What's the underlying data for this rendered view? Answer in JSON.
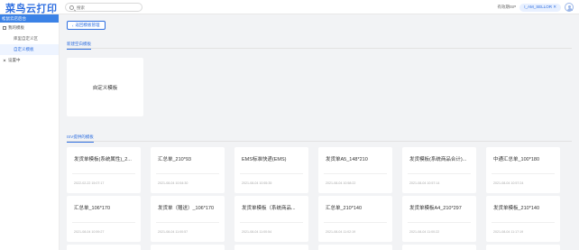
{
  "header": {
    "logo": "菜鸟云打印",
    "search_placeholder": "搜索",
    "link": "有效期ISP",
    "user": "I_AM_SELLOR ✕",
    "accent": "#2f6fe0"
  },
  "sidebar": {
    "title": "松鼠云店后台",
    "group_templates": "我的模板",
    "items": [
      {
        "label": "库里自定义区"
      },
      {
        "label": "自定义模板"
      }
    ],
    "group_settings": "设置中"
  },
  "main": {
    "back_button": "返回模板管理",
    "new_section": "新建空白模板",
    "custom_card": "自定义模板",
    "isv_section": "ISV提供的模板",
    "templates": [
      {
        "name": "发货单模板(系统属性)_2...",
        "date": "2022-02-22 15:07:17"
      },
      {
        "name": "汇总单_210*93",
        "date": "2021-08-04 10:54:30"
      },
      {
        "name": "EMS标准快递(EMS)",
        "date": "2021-08-04 10:55:35"
      },
      {
        "name": "发货单A5_148*210",
        "date": "2021-08-04 10:58:22"
      },
      {
        "name": "发货模板(系统商品合计)...",
        "date": "2021-08-04 10:57:14"
      },
      {
        "name": "中通汇总单_100*180",
        "date": "2021-08-04 10:57:24"
      },
      {
        "name": "汇总单_106*170",
        "date": "2021-08-04 10:59:27"
      },
      {
        "name": "发货单（赠送）_106*170",
        "date": "2021-08-04 11:00:57"
      },
      {
        "name": "发货单模板（系统商品...",
        "date": "2021-08-04 11:00:54"
      },
      {
        "name": "汇总单_210*140",
        "date": "2021-08-04 11:02:19"
      },
      {
        "name": "发货单模板A4_210*297",
        "date": "2021-08-04 11:00:22"
      },
      {
        "name": "发货单模板_210*140",
        "date": "2021-08-04 11:17:19"
      }
    ]
  }
}
